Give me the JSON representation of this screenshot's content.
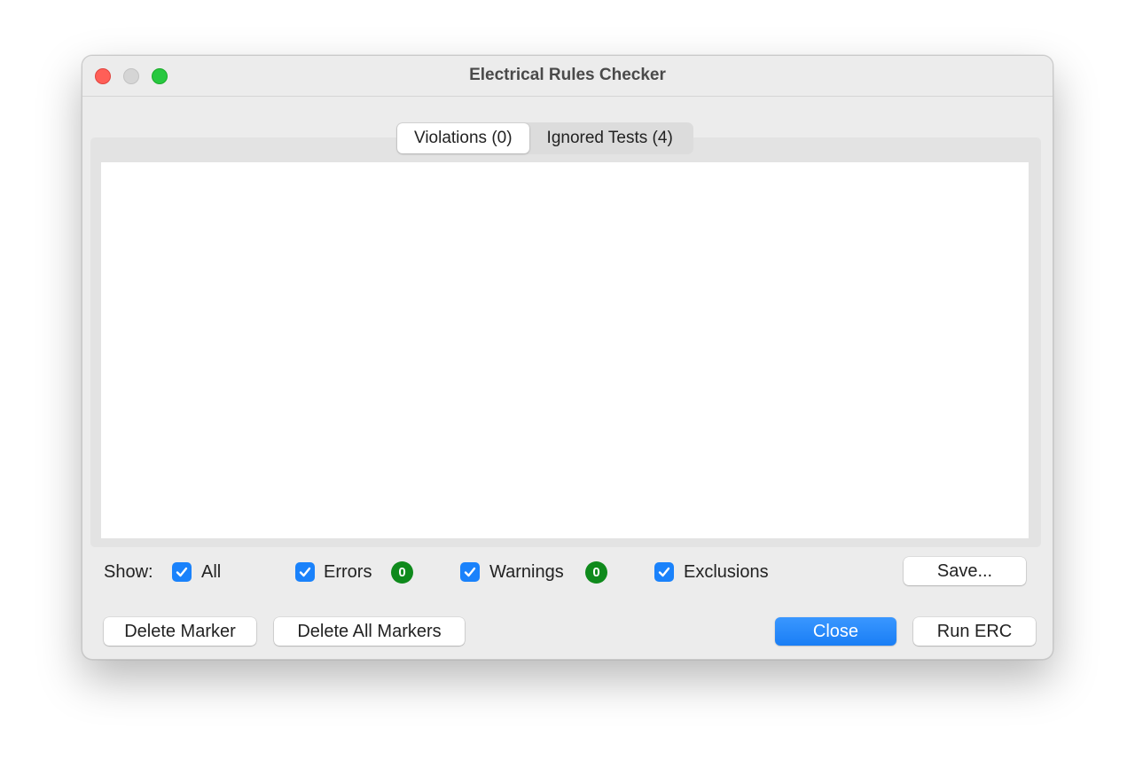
{
  "window": {
    "title": "Electrical Rules Checker"
  },
  "tabs": [
    {
      "label": "Violations (0)",
      "active": true
    },
    {
      "label": "Ignored Tests (4)",
      "active": false
    }
  ],
  "filters": {
    "show_label": "Show:",
    "all": {
      "label": "All",
      "checked": true
    },
    "errors": {
      "label": "Errors",
      "checked": true,
      "count": "0"
    },
    "warnings": {
      "label": "Warnings",
      "checked": true,
      "count": "0"
    },
    "exclusions": {
      "label": "Exclusions",
      "checked": true
    }
  },
  "buttons": {
    "save": "Save...",
    "delete_marker": "Delete Marker",
    "delete_all_markers": "Delete All Markers",
    "close": "Close",
    "run_erc": "Run ERC"
  },
  "colors": {
    "accent": "#1a82fb",
    "badge": "#0f8a1c",
    "close_light": "#ff5f57",
    "maximize_light": "#28c840"
  }
}
